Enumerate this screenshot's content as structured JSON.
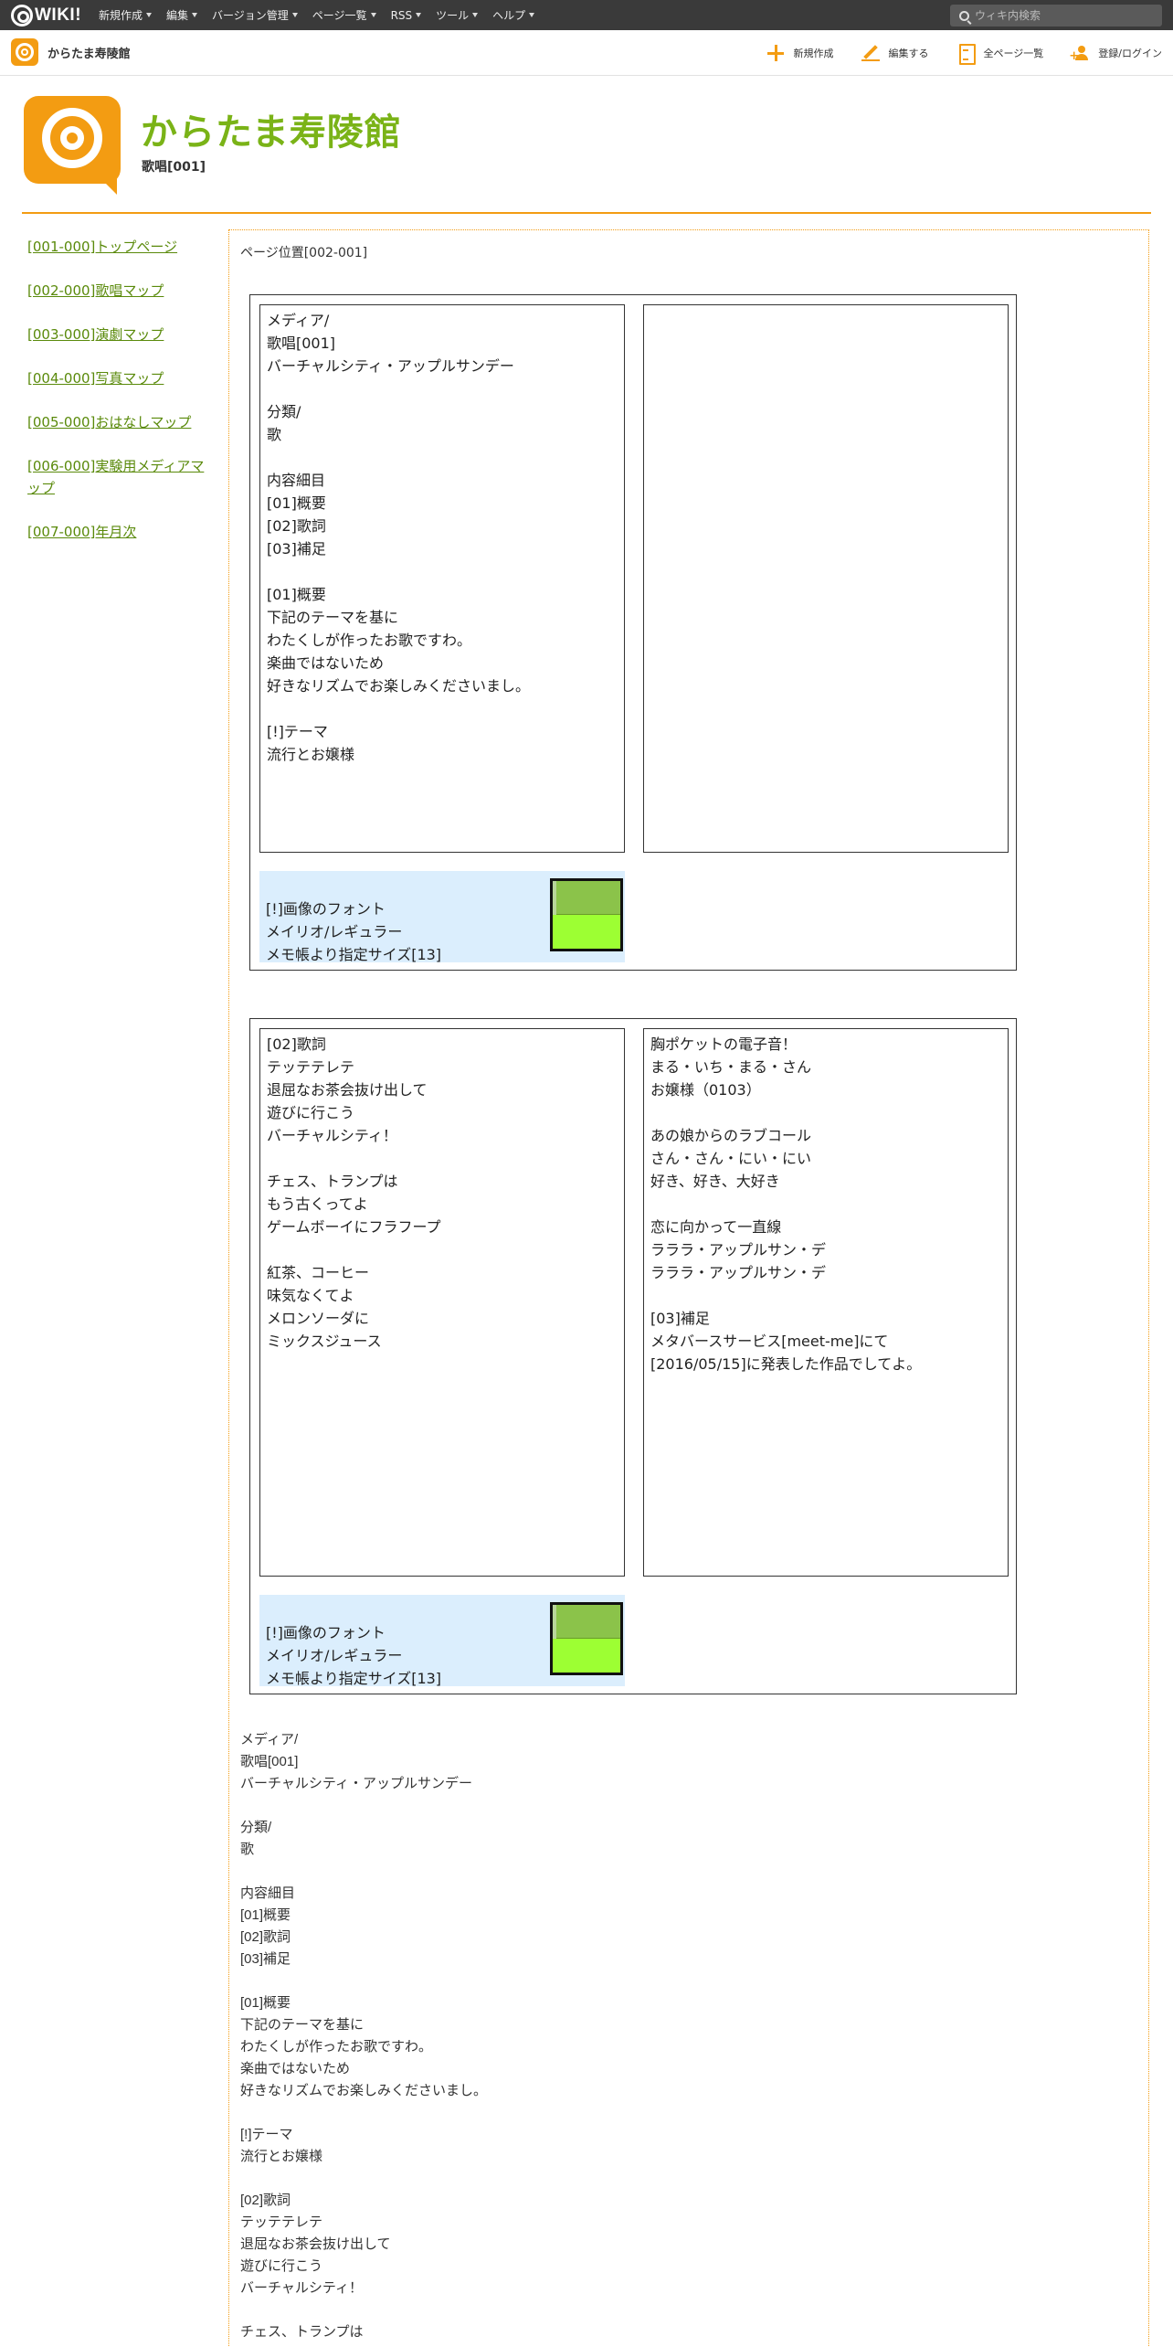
{
  "topbar": {
    "brand": "WIKI!",
    "menus": [
      "新規作成",
      "編集",
      "バージョン管理",
      "ページ一覧",
      "RSS",
      "ツール",
      "ヘルプ"
    ],
    "search_placeholder": "ウィキ内検索"
  },
  "subbar": {
    "site_name": "からたま寿陵館",
    "actions": [
      {
        "label": "新規作成",
        "icon": "plus-icon"
      },
      {
        "label": "編集する",
        "icon": "pencil-icon"
      },
      {
        "label": "全ページ一覧",
        "icon": "document-icon"
      },
      {
        "label": "登録/ログイン",
        "icon": "add-user-icon"
      }
    ]
  },
  "header": {
    "title": "からたま寿陵館",
    "page_name": "歌唱[001]"
  },
  "sidebar": {
    "items": [
      "[001-000]トップページ",
      "[002-000]歌唱マップ",
      "[003-000]演劇マップ",
      "[004-000]写真マップ",
      "[005-000]おはなしマップ",
      "[006-000]実験用メディアマップ",
      "[007-000]年月次"
    ]
  },
  "main": {
    "breadcrumb": "ページ位置[002-001]",
    "panel1": {
      "left": "メディア/\n歌唱[001]\nバーチャルシティ・アップルサンデー\n\n分類/\n歌\n\n内容細目\n[01]概要\n[02]歌詞\n[03]補足\n\n[01]概要\n下記のテーマを基に\nわたくしが作ったお歌ですわ。\n楽曲ではないため\n好きなリズムでお楽しみくださいまし。\n\n[!]テーマ\n流行とお嬢様",
      "right": "",
      "note": "[!]画像のフォント\nメイリオ/レギュラー\nメモ帳より指定サイズ[13]"
    },
    "panel2": {
      "left": "[02]歌詞\nテッテテレテ\n退屈なお茶会抜け出して\n遊びに行こう\nバーチャルシティ！\n\nチェス、トランプは\nもう古くってよ\nゲームボーイにフラフープ\n\n紅茶、コーヒー\n味気なくてよ\nメロンソーダに\nミックスジュース",
      "right": "胸ポケットの電子音！\nまる・いち・まる・さん\nお嬢様（0103）\n\nあの娘からのラブコール\nさん・さん・にい・にい\n好き、好き、大好き\n\n恋に向かって一直線\nラララ・アップルサン・デ\nラララ・アップルサン・デ\n\n[03]補足\nメタバースサービス[meet-me]にて\n[2016/05/15]に発表した作品でしてよ。",
      "note": "[!]画像のフォント\nメイリオ/レギュラー\nメモ帳より指定サイズ[13]"
    },
    "body_text": "メディア/\n歌唱[001]\nバーチャルシティ・アップルサンデー\n\n分類/\n歌\n\n内容細目\n[01]概要\n[02]歌詞\n[03]補足\n\n[01]概要\n下記のテーマを基に\nわたくしが作ったお歌ですわ。\n楽曲ではないため\n好きなリズムでお楽しみくださいまし。\n\n[!]テーマ\n流行とお嬢様\n\n[02]歌詞\nテッテテレテ\n退屈なお茶会抜け出して\n遊びに行こう\nバーチャルシティ！\n\nチェス、トランプは"
  },
  "colors": {
    "accent": "#f39c12",
    "title_green": "#7ab317",
    "link_green": "#5a8a0b",
    "note_bg": "#dbeefd",
    "swatch_top": "#8bc34a",
    "swatch_bottom": "#9dff33"
  }
}
